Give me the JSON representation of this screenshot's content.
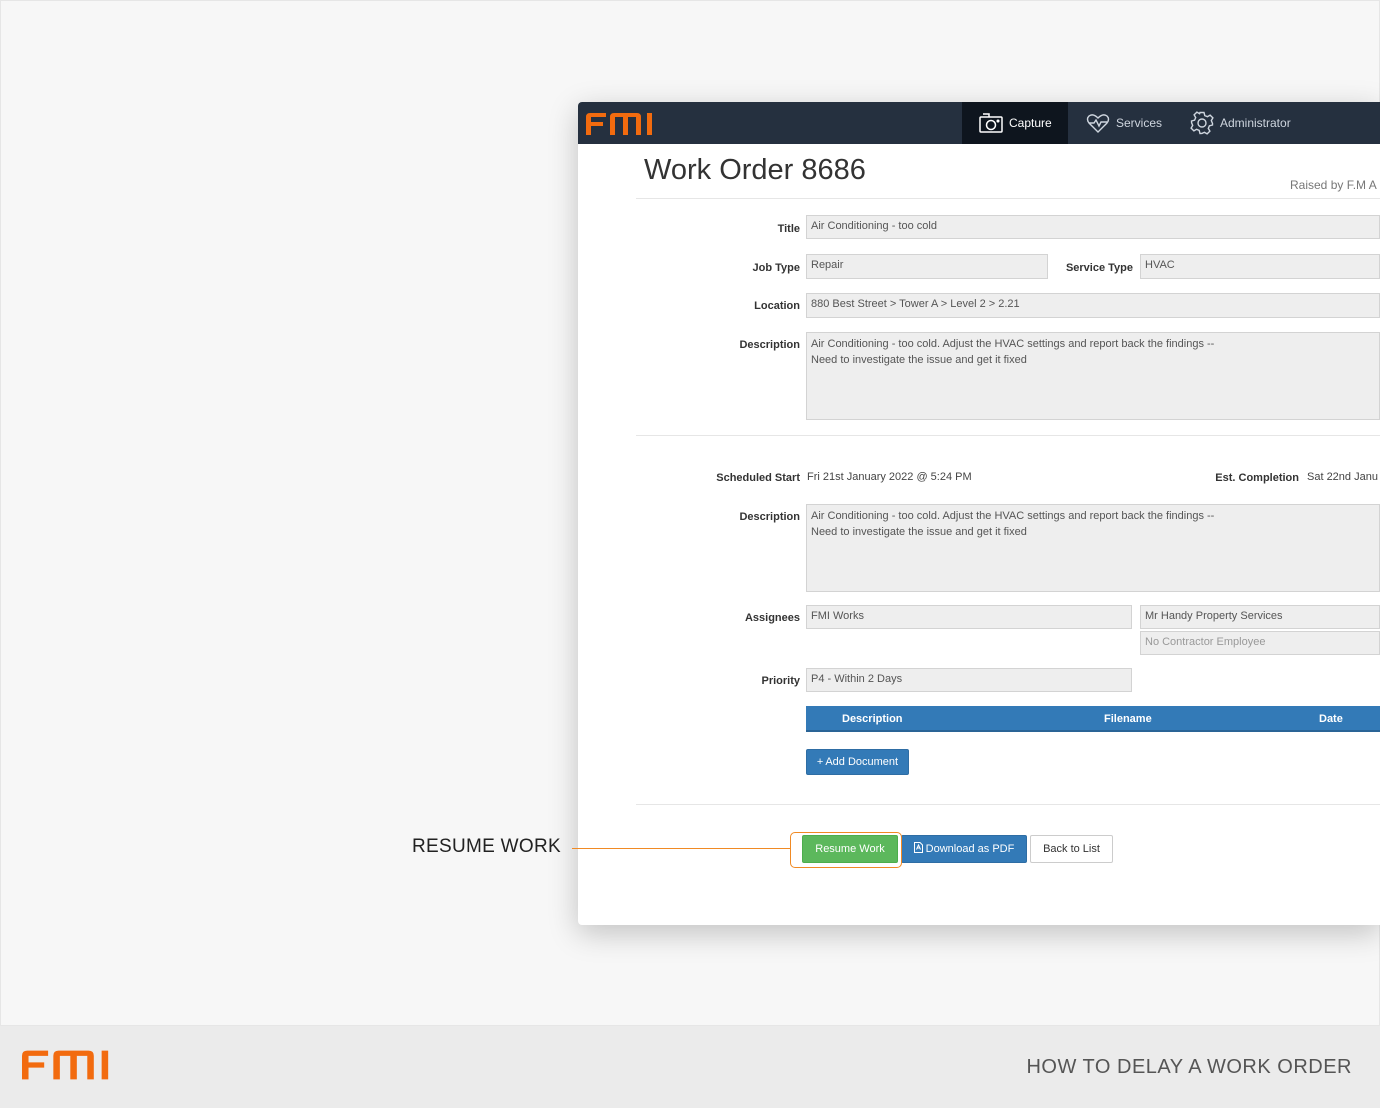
{
  "brand": {
    "logo_text": "FMI",
    "accent_color": "#f26b0f"
  },
  "footer": {
    "title": "HOW TO DELAY A WORK ORDER"
  },
  "callout": {
    "label": "RESUME WORK"
  },
  "navbar": {
    "items": [
      {
        "label": "Capture",
        "icon": "camera-icon",
        "active": true
      },
      {
        "label": "Services",
        "icon": "heartbeat-icon",
        "active": false
      },
      {
        "label": "Administrator",
        "icon": "gear-icon",
        "active": false
      }
    ]
  },
  "work_order": {
    "title": "Work Order 8686",
    "raised_by": "Raised by F.M A",
    "fields": {
      "title_label": "Title",
      "title_value": "Air Conditioning - too cold",
      "job_type_label": "Job Type",
      "job_type_value": "Repair",
      "service_type_label": "Service Type",
      "service_type_value": "HVAC",
      "location_label": "Location",
      "location_value": "880 Best Street > Tower A  > Level 2 > 2.21",
      "description_label": "Description",
      "description_line1": "Air Conditioning - too cold. Adjust the HVAC settings and report back the findings --",
      "description_line2": "Need to investigate the issue and get it fixed"
    },
    "schedule": {
      "scheduled_start_label": "Scheduled Start",
      "scheduled_start_value": "Fri 21st January 2022 @ 5:24 PM",
      "est_completion_label": "Est. Completion",
      "est_completion_value": "Sat 22nd Janu",
      "description_label": "Description",
      "description_line1": "Air Conditioning - too cold. Adjust the HVAC settings and report back the findings --",
      "description_line2": "Need to investigate the issue and get it fixed",
      "assignees_label": "Assignees",
      "assignee_1": "FMI Works",
      "assignee_2": "Mr Handy Property Services",
      "assignee_3_placeholder": "No Contractor Employee",
      "priority_label": "Priority",
      "priority_value": "P4 - Within 2 Days"
    },
    "documents_table": {
      "columns": [
        "Description",
        "Filename",
        "Date"
      ],
      "add_document_label": "Add Document"
    },
    "actions": {
      "resume_work": "Resume Work",
      "download_pdf": "Download as PDF",
      "back_to_list": "Back to List"
    }
  }
}
